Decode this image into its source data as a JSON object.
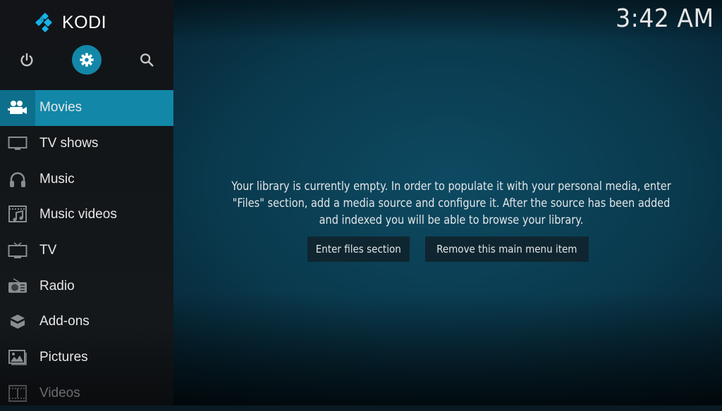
{
  "app": {
    "name": "KODI"
  },
  "clock": {
    "time": "3:42 AM"
  },
  "top_buttons": [
    {
      "name": "power",
      "icon": "power-icon"
    },
    {
      "name": "settings",
      "icon": "gear-icon",
      "active": true
    },
    {
      "name": "search",
      "icon": "search-icon"
    }
  ],
  "menu": {
    "items": [
      {
        "label": "Movies",
        "icon": "movie-camera-icon",
        "active": true
      },
      {
        "label": "TV shows",
        "icon": "monitor-icon"
      },
      {
        "label": "Music",
        "icon": "headphones-icon"
      },
      {
        "label": "Music videos",
        "icon": "music-video-icon"
      },
      {
        "label": "TV",
        "icon": "tv-icon"
      },
      {
        "label": "Radio",
        "icon": "radio-icon"
      },
      {
        "label": "Add-ons",
        "icon": "box-icon"
      },
      {
        "label": "Pictures",
        "icon": "pictures-icon"
      },
      {
        "label": "Videos",
        "icon": "film-icon"
      }
    ]
  },
  "main": {
    "message": "Your library is currently empty. In order to populate it with your personal media, enter \"Files\" section, add a media source and configure it. After the source has been added and indexed you will be able to browse your library.",
    "buttons": {
      "enter_files": "Enter files section",
      "remove_item": "Remove this main menu item"
    }
  },
  "colors": {
    "accent": "#1287a8",
    "accent_dark": "#0e6f8c",
    "sidebar": "#14181b"
  }
}
